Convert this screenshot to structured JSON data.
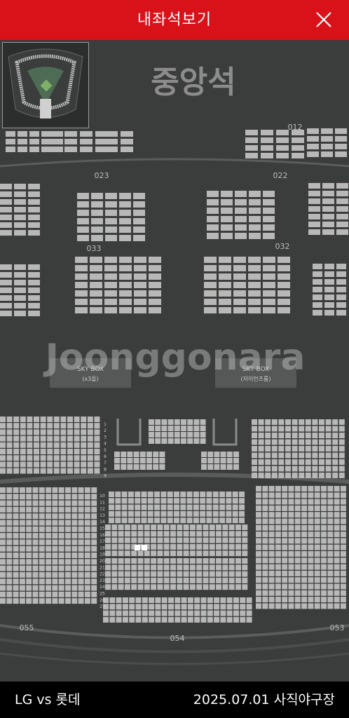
{
  "header": {
    "title": "내좌석보기",
    "close_icon": "close-icon"
  },
  "map": {
    "section_heading": "중앙석",
    "section_labels": [
      "012",
      "023",
      "022",
      "033",
      "032",
      "055",
      "054",
      "053"
    ],
    "skybox_left": {
      "line1": "SKY BOX",
      "line2": "(x3을)"
    },
    "skybox_right": {
      "line1": "SKY BOX",
      "line2": "(자이언츠룸)"
    },
    "watermark": "Joonggonara",
    "row_numbers_upper": [
      "1",
      "2",
      "3",
      "4",
      "5",
      "6",
      "7",
      "8",
      "9"
    ],
    "row_numbers_lower": [
      "10",
      "11",
      "12",
      "13",
      "14",
      "15",
      "16",
      "17",
      "18",
      "19",
      "20",
      "21",
      "22",
      "23",
      "24",
      "25",
      "26",
      "27"
    ],
    "colors": {
      "seat": "#b8b8b8",
      "selected_seat": "#ffffff",
      "background": "#3a3d3b",
      "accent": "#d9121a"
    }
  },
  "footer": {
    "match": "LG vs 롯데",
    "date": "2025.07.01",
    "venue": "사직야구장"
  }
}
